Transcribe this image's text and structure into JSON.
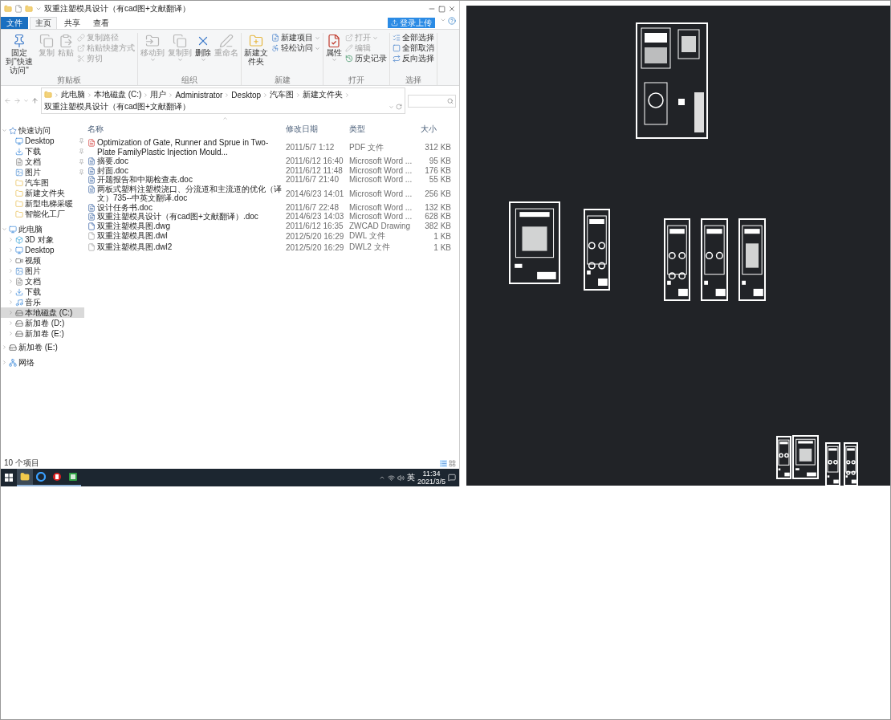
{
  "window": {
    "title": "双重注塑模具设计（有cad图+文献翻译）"
  },
  "ribbon_tabs": [
    {
      "label": "文件",
      "kind": "file",
      "selected": false
    },
    {
      "label": "主页",
      "kind": "tab",
      "selected": true
    },
    {
      "label": "共享",
      "kind": "tab",
      "selected": false
    },
    {
      "label": "查看",
      "kind": "tab",
      "selected": false
    }
  ],
  "upload_button": {
    "label": "登录上传"
  },
  "ribbon_groups": [
    {
      "label": "剪贴板",
      "buttons": [
        {
          "label": "固定到\"快速访问\"",
          "kind": "large",
          "disabled": false,
          "menu": false
        },
        {
          "label": "复制",
          "kind": "large",
          "disabled": true,
          "menu": false
        },
        {
          "label": "粘贴",
          "kind": "large",
          "disabled": true,
          "menu": false
        },
        {
          "label": "复制路径",
          "kind": "small",
          "disabled": true,
          "menu": false
        },
        {
          "label": "粘贴快捷方式",
          "kind": "small",
          "disabled": true,
          "menu": false
        },
        {
          "label": "剪切",
          "kind": "small",
          "disabled": true,
          "menu": false
        }
      ]
    },
    {
      "label": "组织",
      "buttons": [
        {
          "label": "移动到",
          "kind": "large",
          "disabled": true,
          "menu": true
        },
        {
          "label": "复制到",
          "kind": "large",
          "disabled": true,
          "menu": true
        },
        {
          "label": "删除",
          "kind": "large",
          "disabled": false,
          "menu": true
        },
        {
          "label": "重命名",
          "kind": "large",
          "disabled": true,
          "menu": false
        }
      ]
    },
    {
      "label": "新建",
      "buttons": [
        {
          "label": "新建文件夹",
          "kind": "large",
          "disabled": false,
          "menu": false
        },
        {
          "label": "新建项目",
          "kind": "small",
          "disabled": false,
          "menu": true
        },
        {
          "label": "轻松访问",
          "kind": "small",
          "disabled": false,
          "menu": true
        }
      ]
    },
    {
      "label": "打开",
      "buttons": [
        {
          "label": "属性",
          "kind": "large",
          "disabled": false,
          "menu": true
        },
        {
          "label": "打开",
          "kind": "small",
          "disabled": true,
          "menu": true
        },
        {
          "label": "编辑",
          "kind": "small",
          "disabled": true,
          "menu": false
        },
        {
          "label": "历史记录",
          "kind": "small",
          "disabled": false,
          "menu": false
        }
      ]
    },
    {
      "label": "选择",
      "buttons": [
        {
          "label": "全部选择",
          "kind": "small",
          "disabled": false,
          "menu": false
        },
        {
          "label": "全部取消",
          "kind": "small",
          "disabled": false,
          "menu": false
        },
        {
          "label": "反向选择",
          "kind": "small",
          "disabled": false,
          "menu": false
        }
      ]
    }
  ],
  "address": {
    "crumbs": [
      "此电脑",
      "本地磁盘 (C:)",
      "用户",
      "Administrator",
      "Desktop",
      "汽车图",
      "新建文件夹",
      "双重注塑模具设计（有cad图+文献翻译）"
    ]
  },
  "sidebar": {
    "items": [
      {
        "label": "快速访问",
        "kind": "star",
        "expanded": true,
        "selected": false,
        "children": [
          {
            "label": "Desktop",
            "kind": "desktop",
            "pinned": true,
            "selected": false
          },
          {
            "label": "下载",
            "kind": "download",
            "pinned": true,
            "selected": false
          },
          {
            "label": "文档",
            "kind": "documents",
            "pinned": true,
            "selected": false
          },
          {
            "label": "图片",
            "kind": "pictures",
            "pinned": true,
            "selected": false
          },
          {
            "label": "汽车图",
            "kind": "folder",
            "pinned": false,
            "selected": false
          },
          {
            "label": "新建文件夹",
            "kind": "folder",
            "pinned": false,
            "selected": false
          },
          {
            "label": "新型电梯采暖",
            "kind": "folder",
            "pinned": false,
            "selected": false
          },
          {
            "label": "智能化工厂",
            "kind": "folder",
            "pinned": false,
            "selected": false
          }
        ]
      },
      {
        "label": "此电脑",
        "kind": "pc",
        "expanded": true,
        "selected": false,
        "children": [
          {
            "label": "3D 对象",
            "kind": "objects3d",
            "expanded": false,
            "selected": false
          },
          {
            "label": "Desktop",
            "kind": "desktop",
            "expanded": false,
            "selected": false
          },
          {
            "label": "视频",
            "kind": "videos",
            "expanded": false,
            "selected": false
          },
          {
            "label": "图片",
            "kind": "pictures",
            "expanded": false,
            "selected": false
          },
          {
            "label": "文档",
            "kind": "documents",
            "expanded": false,
            "selected": false
          },
          {
            "label": "下载",
            "kind": "download",
            "expanded": false,
            "selected": false
          },
          {
            "label": "音乐",
            "kind": "music",
            "expanded": false,
            "selected": false
          },
          {
            "label": "本地磁盘 (C:)",
            "kind": "disk",
            "expanded": false,
            "selected": true
          },
          {
            "label": "新加卷 (D:)",
            "kind": "drive",
            "expanded": false,
            "selected": false
          },
          {
            "label": "新加卷 (E:)",
            "kind": "drive",
            "expanded": false,
            "selected": false
          }
        ]
      },
      {
        "label": "新加卷 (E:)",
        "kind": "drive",
        "expanded": false,
        "selected": false
      },
      {
        "label": "网络",
        "kind": "network",
        "expanded": false,
        "selected": false
      }
    ]
  },
  "file_list": {
    "columns": [
      "名称",
      "修改日期",
      "类型",
      "大小"
    ],
    "rows": [
      {
        "kind": "pdf",
        "name": "Optimization of Gate, Runner and Sprue in Two-Plate FamilyPlastic Injection Mould...",
        "modified": "2011/5/7 1:12",
        "type": "PDF 文件",
        "size": "312 KB",
        "selected": false
      },
      {
        "kind": "word",
        "name": "摘要.doc",
        "modified": "2011/6/12 16:40",
        "type": "Microsoft Word ...",
        "size": "95 KB",
        "selected": false
      },
      {
        "kind": "word",
        "name": "封面.doc",
        "modified": "2011/6/12 11:48",
        "type": "Microsoft Word ...",
        "size": "176 KB",
        "selected": false
      },
      {
        "kind": "word",
        "name": "开题报告和中期检查表.doc",
        "modified": "2011/6/7 21:40",
        "type": "Microsoft Word ...",
        "size": "55 KB",
        "selected": false
      },
      {
        "kind": "word",
        "name": "两板式塑料注塑模浇口、分流道和主流道的优化（译文）735--中英文翻译.doc",
        "modified": "2014/6/23 14:01",
        "type": "Microsoft Word ...",
        "size": "256 KB",
        "selected": false
      },
      {
        "kind": "word",
        "name": "设计任务书.doc",
        "modified": "2011/6/7 22:48",
        "type": "Microsoft Word ...",
        "size": "132 KB",
        "selected": false
      },
      {
        "kind": "word",
        "name": "双重注塑模具设计（有cad图+文献翻译）.doc",
        "modified": "2014/6/23 14:03",
        "type": "Microsoft Word ...",
        "size": "628 KB",
        "selected": false
      },
      {
        "kind": "dwg",
        "name": "双重注塑模具图.dwg",
        "modified": "2011/6/12 16:35",
        "type": "ZWCAD Drawing",
        "size": "382 KB",
        "selected": false
      },
      {
        "kind": "file",
        "name": "双重注塑模具图.dwl",
        "modified": "2012/5/20 16:29",
        "type": "DWL 文件",
        "size": "1 KB",
        "selected": false
      },
      {
        "kind": "file",
        "name": "双重注塑模具图.dwl2",
        "modified": "2012/5/20 16:29",
        "type": "DWL2 文件",
        "size": "1 KB",
        "selected": false
      }
    ]
  },
  "status_bar": {
    "item_count": "10 个项目"
  },
  "taskbar": {
    "apps": [
      {
        "active": true
      },
      {
        "active": false
      },
      {
        "active": false
      },
      {
        "active": false
      }
    ],
    "language": "英",
    "time": "11:34",
    "date": "2021/3/5"
  }
}
